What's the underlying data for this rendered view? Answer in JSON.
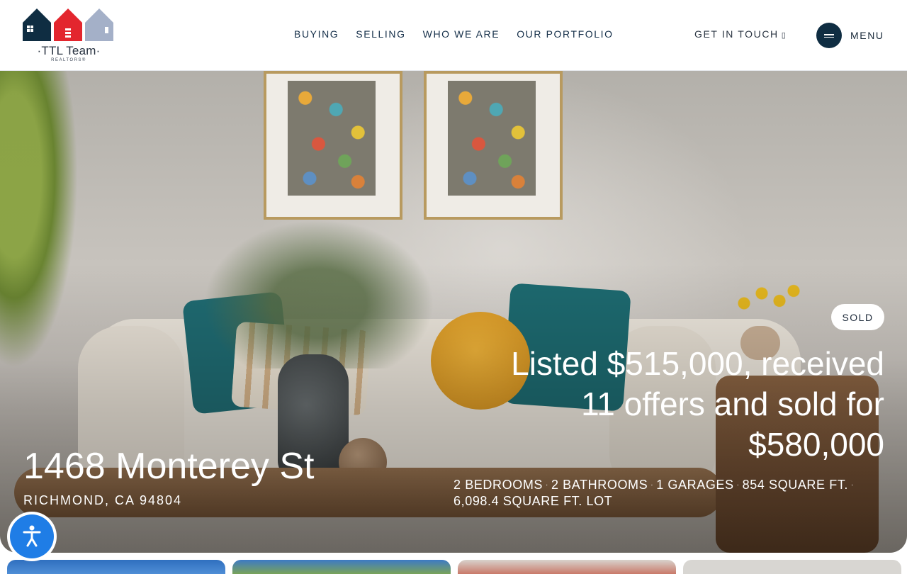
{
  "header": {
    "logo": {
      "name": "·TTL Team·",
      "sub": "REALTORS®",
      "icon": "houses-logo-icon"
    },
    "nav": [
      "BUYING",
      "SELLING",
      "WHO WE ARE",
      "OUR PORTFOLIO"
    ],
    "contact_label": "GET IN TOUCH",
    "contact_icon": "chevron-down-icon",
    "menu_label": "MENU",
    "menu_icon": "hamburger-icon"
  },
  "listing": {
    "status": "SOLD",
    "headline_line1": "Listed $515,000, received",
    "headline_line2": "11 offers and sold for",
    "headline_line3": "$580,000",
    "address": "1468 Monterey St",
    "city": "RICHMOND, CA 94804",
    "bedrooms": "2 BEDROOMS",
    "bathrooms": "2 BATHROOMS",
    "garages": "1 GARAGES",
    "sqft": "854 SQUARE FT.",
    "lot": "6,098.4 SQUARE FT. LOT"
  },
  "accessibility": {
    "icon": "accessibility-icon"
  },
  "colors": {
    "brand_navy": "#0f2d42",
    "logo_red": "#e3262e",
    "logo_slate": "#a4b0c8",
    "accessibility_blue": "#1f7de6"
  }
}
